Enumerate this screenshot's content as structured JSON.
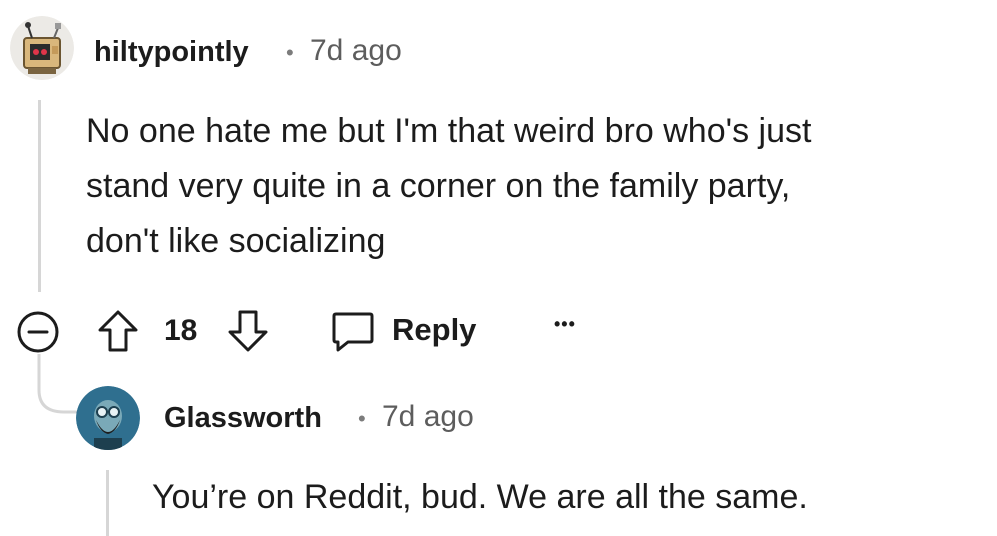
{
  "comment": {
    "username": "hiltypointly",
    "separator": "•",
    "time": "7d ago",
    "body_lines": [
      "No one hate me but I'm that weird bro who's just",
      "stand very quite in a corner on the family party,",
      "don't like socializing"
    ],
    "vote_count": "18",
    "reply_label": "Reply",
    "more_label": "•••"
  },
  "reply": {
    "username": "Glassworth",
    "separator": "•",
    "time": "7d ago",
    "body_lines": [
      "You’re on Reddit, bud. We are all the same."
    ]
  }
}
